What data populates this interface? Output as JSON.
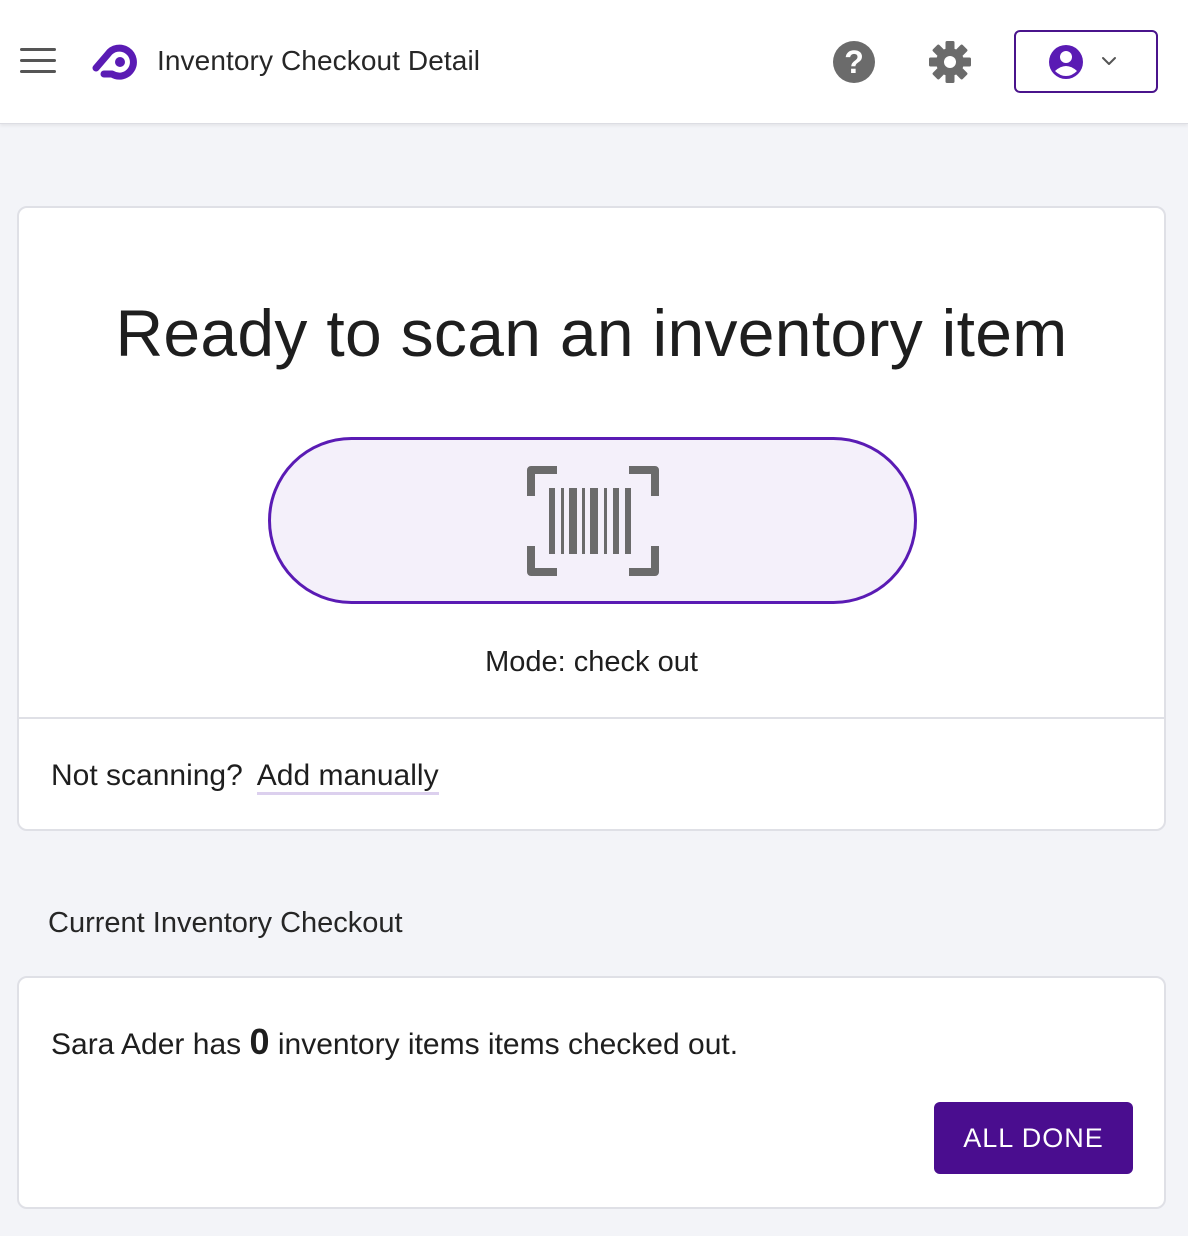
{
  "header": {
    "title": "Inventory Checkout Detail",
    "menu_icon": "hamburger-menu-icon",
    "logo_icon": "app-logo-icon",
    "help_icon": "help-icon",
    "settings_icon": "gear-icon",
    "account_icon": "account-avatar-icon",
    "account_chevron": "chevron-down-icon"
  },
  "scanner": {
    "title": "Ready to scan an inventory item",
    "scan_icon": "barcode-scan-icon",
    "mode": "Mode: check out",
    "manual_prompt": "Not scanning?",
    "manual_link": "Add manually"
  },
  "checkout": {
    "section_title": "Current Inventory Checkout",
    "person": "Sara Ader",
    "has_text": "has",
    "count": "0",
    "suffix": "inventory items items checked out.",
    "done_label": "ALL DONE"
  },
  "colors": {
    "accent": "#4a0d8f",
    "accent_light": "#f4f0fa",
    "background": "#f3f4f8",
    "icon_gray": "#6b6b6b"
  }
}
